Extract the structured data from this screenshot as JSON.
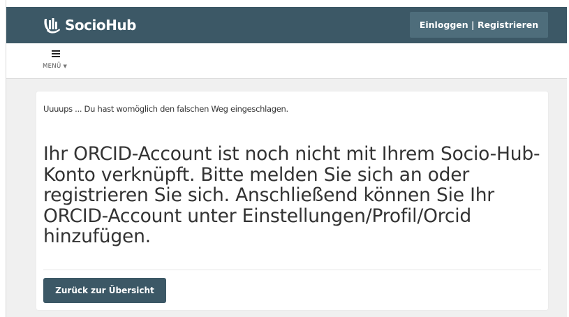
{
  "header": {
    "logo_text": "SocioHub",
    "auth_button_label": "Einloggen | Registrieren",
    "bg_color": "#3c5866"
  },
  "subnav": {
    "menu_label": "MENÜ",
    "menu_icon": "hamburger-icon"
  },
  "main": {
    "oops_text": "Uuuups ... Du hast womöglich den falschen Weg eingeschlagen.",
    "headline": "Ihr ORCID-Account ist noch nicht mit Ihrem Socio-Hub-Konto verknüpft. Bitte melden Sie sich an oder registrieren Sie sich. Anschließend können Sie Ihr ORCID-Account unter Einstellungen/Profil/Orcid hinzufügen.",
    "back_button_label": "Zurück zur Übersicht"
  }
}
